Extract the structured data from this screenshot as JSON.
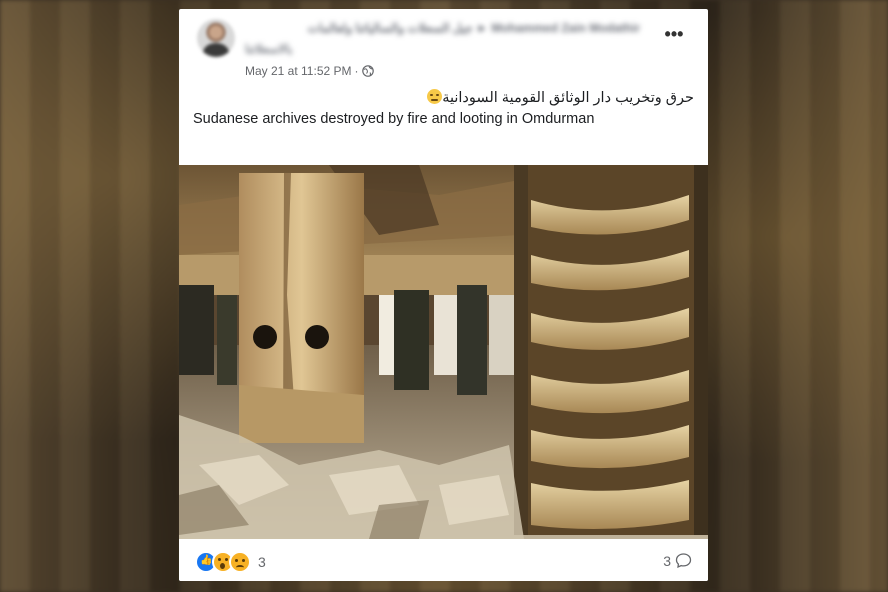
{
  "post": {
    "author_name_line1": "Mohammed Zain Modathir ► جيل السعلات والسالياتنا ولعالمات",
    "author_name_line2": "بالاسعلاتنا",
    "timestamp": "May 21 at 11:52 PM",
    "separator": "·",
    "audience_icon": "globe-icon",
    "more_icon": "more-icon",
    "more_label": "•••",
    "text_arabic": "حرق وتخريب دار الوثائق القومية السودانية",
    "emoji_icon": "thinking-face-emoji",
    "text_english": "Sudanese archives destroyed by fire and looting in Omdurman"
  },
  "footer": {
    "reaction_icons": [
      "like-icon",
      "wow-icon",
      "sad-icon"
    ],
    "reaction_count": "3",
    "comment_count": "3",
    "comment_icon": "comment-icon"
  },
  "colors": {
    "like_blue": "#1877f2",
    "reaction_yellow": "#f7b125",
    "meta_gray": "#65676b",
    "text": "#1c1e21"
  }
}
